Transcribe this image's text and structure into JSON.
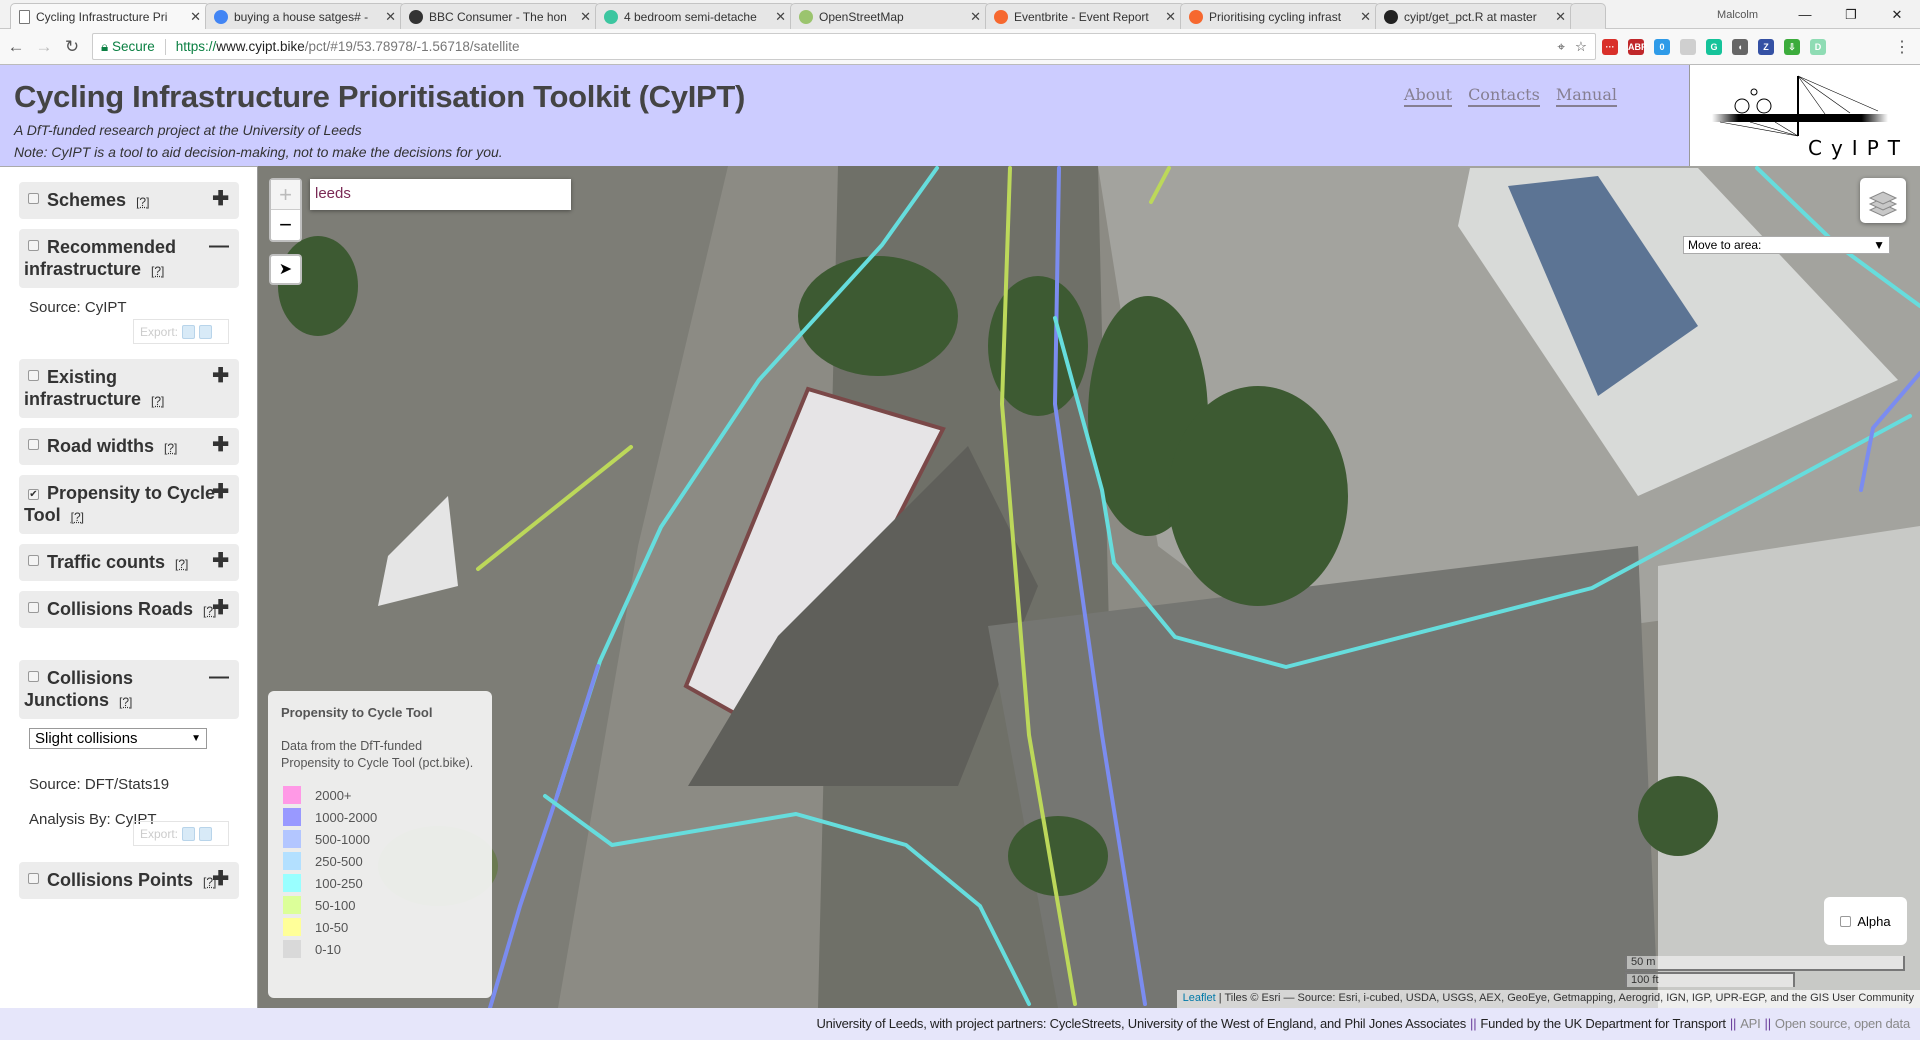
{
  "browser": {
    "tabs": [
      {
        "title": "Cycling Infrastructure Pri",
        "icon": "page-icon",
        "color": "#ffffff",
        "active": true
      },
      {
        "title": "buying a house satges# -",
        "icon": "google-icon",
        "color": "#4285f4"
      },
      {
        "title": "BBC Consumer - The hon",
        "icon": "bbc-icon",
        "color": "#333333"
      },
      {
        "title": "4 bedroom semi-detache",
        "icon": "house-icon",
        "color": "#3cc6a0"
      },
      {
        "title": "OpenStreetMap",
        "icon": "osm-icon",
        "color": "#9bc46e"
      },
      {
        "title": "Eventbrite - Event Report",
        "icon": "eventbrite-icon",
        "color": "#f6682f"
      },
      {
        "title": "Prioritising cycling infrast",
        "icon": "eventbrite-icon",
        "color": "#f6682f"
      },
      {
        "title": "cyipt/get_pct.R at master",
        "icon": "github-icon",
        "color": "#222222"
      }
    ],
    "user": "Malcolm",
    "secure_label": "Secure",
    "url_scheme": "https://",
    "url_host": "www.cyipt.bike",
    "url_path": "/pct/#19/53.78978/-1.56718/satellite",
    "extensions": [
      {
        "label": "···",
        "color": "#d9302a"
      },
      {
        "label": "ABP",
        "color": "#c0282b"
      },
      {
        "label": "0",
        "color": "#2f9be8"
      },
      {
        "label": "",
        "color": "#cfcfcf"
      },
      {
        "label": "G",
        "color": "#15c39a"
      },
      {
        "label": "◖",
        "color": "#666666"
      },
      {
        "label": "Z",
        "color": "#3551a4"
      },
      {
        "label": "⇩",
        "color": "#3cac3c"
      },
      {
        "label": "D",
        "color": "#8fdcb4"
      }
    ]
  },
  "header": {
    "title": "Cycling Infrastructure Prioritisation Toolkit (CyIPT)",
    "subtitle": "A DfT-funded research project at the University of Leeds",
    "note": "Note: CyIPT is a tool to aid decision-making, not to make the decisions for you.",
    "links": [
      "About",
      "Contacts",
      "Manual"
    ],
    "logo_text": "CyIPT"
  },
  "sidebar": {
    "help": "[?]",
    "export_label": "Export:",
    "layers": [
      {
        "label": "Schemes",
        "checked": false,
        "expanded": false
      },
      {
        "label": "Recommended infrastructure",
        "checked": false,
        "expanded": true,
        "source": "Source: CyIPT"
      },
      {
        "label": "Existing infrastructure",
        "checked": false,
        "expanded": false
      },
      {
        "label": "Road widths",
        "checked": false,
        "expanded": false
      },
      {
        "label": "Propensity to Cycle Tool",
        "checked": true,
        "expanded": false
      },
      {
        "label": "Traffic counts",
        "checked": false,
        "expanded": false
      },
      {
        "label": "Collisions Roads",
        "checked": false,
        "expanded": false
      },
      {
        "label": "Collisions Junctions",
        "checked": false,
        "expanded": true,
        "select_value": "Slight collisions",
        "source": "Source: DFT/Stats19",
        "analysis": "Analysis By: CyIPT"
      },
      {
        "label": "Collisions Points",
        "checked": false,
        "expanded": false
      }
    ]
  },
  "map": {
    "search_value": "leeds",
    "zoom_in": "+",
    "zoom_out": "−",
    "move_to_area": "Move to area:",
    "alpha_label": "Alpha",
    "alpha_checked": false,
    "scale_metric": "50 m",
    "scale_imperial": "100 ft",
    "attribution_link": "Leaflet",
    "attribution_text": " | Tiles © Esri — Source: Esri, i-cubed, USDA, USGS, AEX, GeoEye, Getmapping, Aerogrid, IGN, IGP, UPR-EGP, and the GIS User Community",
    "legend": {
      "title": "Propensity to Cycle Tool",
      "description": "Data from the DfT-funded Propensity to Cycle Tool (pct.bike).",
      "items": [
        {
          "label": "2000+",
          "color": "#ff99e6"
        },
        {
          "label": "1000-2000",
          "color": "#9999ff"
        },
        {
          "label": "500-1000",
          "color": "#b3c6ff"
        },
        {
          "label": "250-500",
          "color": "#b3e0ff"
        },
        {
          "label": "100-250",
          "color": "#99ffff"
        },
        {
          "label": "50-100",
          "color": "#dcff99"
        },
        {
          "label": "10-50",
          "color": "#ffff99"
        },
        {
          "label": "0-10",
          "color": "#d9d9d9"
        }
      ]
    }
  },
  "footer": {
    "partners": "University of Leeds, with project partners: CycleStreets, University of the West of England, and Phil Jones Associates",
    "sep": "||",
    "funded": "Funded by the UK Department for Transport",
    "api": "API",
    "open": "Open source, open data"
  }
}
